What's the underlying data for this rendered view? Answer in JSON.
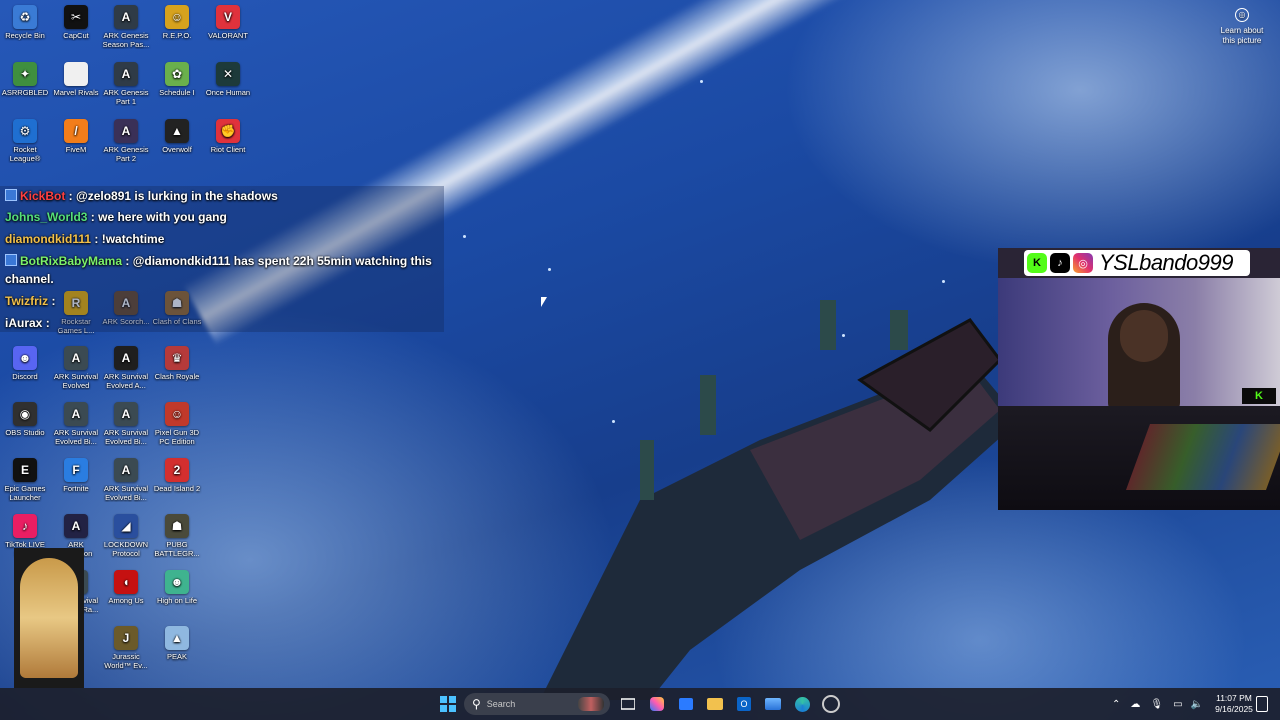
{
  "desktop_icons": [
    {
      "label": "Recycle Bin",
      "icon": "recycle-bin-icon",
      "color": "#3a7bd5",
      "glyph": "♻"
    },
    {
      "label": "CapCut",
      "icon": "capcut-icon",
      "color": "#111111",
      "glyph": "✂"
    },
    {
      "label": "ARK Genesis Season Pas...",
      "icon": "ark-icon",
      "color": "#2f3b47",
      "glyph": "A"
    },
    {
      "label": "R.E.P.O.",
      "icon": "repo-icon",
      "color": "#d6a21e",
      "glyph": "☺"
    },
    {
      "label": "VALORANT",
      "icon": "valorant-icon",
      "color": "#e0323c",
      "glyph": "V"
    },
    {
      "label": "ASRRGBLED",
      "icon": "asrrgbled-icon",
      "color": "#3f8f3f",
      "glyph": "✦"
    },
    {
      "label": "Marvel Rivals",
      "icon": "file-icon",
      "color": "#f0f0f0",
      "glyph": ""
    },
    {
      "label": "ARK Genesis Part 1",
      "icon": "ark-icon",
      "color": "#2f3b47",
      "glyph": "A"
    },
    {
      "label": "Schedule I",
      "icon": "schedule-icon",
      "color": "#6ab04c",
      "glyph": "✿"
    },
    {
      "label": "Once Human",
      "icon": "once-human-icon",
      "color": "#1d3a3a",
      "glyph": "✕"
    },
    {
      "label": "Rocket League®",
      "icon": "rocket-league-icon",
      "color": "#1f6fd1",
      "glyph": "⚙"
    },
    {
      "label": "FiveM",
      "icon": "fivem-icon",
      "color": "#f27d1a",
      "glyph": "/"
    },
    {
      "label": "ARK Genesis Part 2",
      "icon": "ark-icon",
      "color": "#3a3057",
      "glyph": "A"
    },
    {
      "label": "Overwolf",
      "icon": "overwolf-icon",
      "color": "#222222",
      "glyph": "▲"
    },
    {
      "label": "Riot Client",
      "icon": "riot-client-icon",
      "color": "#e0323c",
      "glyph": "✊"
    },
    {
      "label": "Discord",
      "icon": "discord-icon",
      "color": "#5865f2",
      "glyph": "☻"
    },
    {
      "label": "ARK Survival Evolved",
      "icon": "ark-icon",
      "color": "#3b4a52",
      "glyph": "A"
    },
    {
      "label": "ARK Survival Evolved A...",
      "icon": "ark-icon",
      "color": "#1f1f1f",
      "glyph": "A"
    },
    {
      "label": "Clash Royale",
      "icon": "clash-royale-icon",
      "color": "#b53a3a",
      "glyph": "♛"
    },
    {
      "label": "OBS Studio",
      "icon": "obs-icon",
      "color": "#303030",
      "glyph": "◉"
    },
    {
      "label": "ARK Survival Evolved Bi...",
      "icon": "ark-icon",
      "color": "#3b4a52",
      "glyph": "A"
    },
    {
      "label": "ARK Survival Evolved Bi...",
      "icon": "ark-icon",
      "color": "#3b4a52",
      "glyph": "A"
    },
    {
      "label": "Pixel Gun 3D PC Edition",
      "icon": "pixel-gun-icon",
      "color": "#c0392b",
      "glyph": "☺"
    },
    {
      "label": "Epic Games Launcher",
      "icon": "epic-games-icon",
      "color": "#111111",
      "glyph": "E"
    },
    {
      "label": "Fortnite",
      "icon": "fortnite-icon",
      "color": "#2a7de1",
      "glyph": "F"
    },
    {
      "label": "ARK Survival Evolved Bi...",
      "icon": "ark-icon",
      "color": "#3b4a52",
      "glyph": "A"
    },
    {
      "label": "Dead Island 2",
      "icon": "dead-island-icon",
      "color": "#d32f2f",
      "glyph": "2"
    },
    {
      "label": "TikTok LIVE Studio",
      "icon": "tiktok-live-icon",
      "color": "#e91e63",
      "glyph": "♪"
    },
    {
      "label": "ARK Extinction",
      "icon": "ark-icon",
      "color": "#222244",
      "glyph": "A"
    },
    {
      "label": "LOCKDOWN Protocol",
      "icon": "lockdown-icon",
      "color": "#2a4f9e",
      "glyph": "◢"
    },
    {
      "label": "PUBG BATTLEGR...",
      "icon": "pubg-icon",
      "color": "#4a4a3a",
      "glyph": "☗"
    },
    {
      "label": "ARK Survival Evolved Ra...",
      "icon": "ark-icon",
      "color": "#3b4a52",
      "glyph": "A"
    },
    {
      "label": "Among Us",
      "icon": "among-us-icon",
      "color": "#c51111",
      "glyph": "◖"
    },
    {
      "label": "High on Life",
      "icon": "high-on-life-icon",
      "color": "#3fb38f",
      "glyph": "☻"
    },
    {
      "label": "Jurassic World™ Ev...",
      "icon": "jurassic-icon",
      "color": "#6b5a2a",
      "glyph": "J"
    },
    {
      "label": "PEAK",
      "icon": "peak-icon",
      "color": "#8fb8e0",
      "glyph": "▲"
    },
    {
      "label": "Rockstar Games L...",
      "icon": "rockstar-icon",
      "color": "#f0b400",
      "glyph": "R"
    },
    {
      "label": "ARK Scorch...",
      "icon": "ark-icon",
      "color": "#6b4a2a",
      "glyph": "A"
    },
    {
      "label": "Clash of Clans",
      "icon": "clash-clans-icon",
      "color": "#9b6b2a",
      "glyph": "☗"
    }
  ],
  "chat": [
    {
      "user": "KickBot",
      "user_color": "#ff4040",
      "text": ": @zelo891 is lurking in the shadows",
      "badge": true
    },
    {
      "user": "Johns_World3",
      "user_color": "#55e07a",
      "text": ": we here with you gang",
      "badge": false
    },
    {
      "user": "diamondkid111",
      "user_color": "#f2c04a",
      "text": ": !watchtime",
      "badge": false
    },
    {
      "user": "BotRixBabyMama",
      "user_color": "#7cf26a",
      "text": ": @diamondkid111 has spent 22h 55min watching this",
      "badge": true
    },
    {
      "user": "",
      "user_color": "#ffffff",
      "text": "channel.",
      "badge": false
    },
    {
      "user": "Twizfriz",
      "user_color": "#f2c04a",
      "text": ":",
      "badge": false
    },
    {
      "user": "iAurax",
      "user_color": "#ffffff",
      "text": ":",
      "badge": false
    }
  ],
  "learn": {
    "label": "Learn about this picture"
  },
  "stream": {
    "name": "YSLbando999",
    "kick_tag": "K"
  },
  "taskbar": {
    "search_placeholder": "Search",
    "time": "11:07 PM",
    "date": "9/16/2025"
  }
}
